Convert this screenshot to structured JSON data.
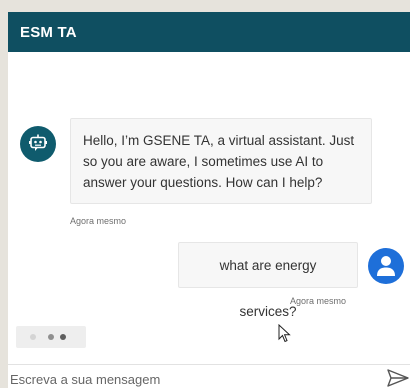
{
  "header": {
    "title": "ESM TA"
  },
  "messages": [
    {
      "sender": "bot",
      "avatar_icon": "bot-icon",
      "text": "Hello, I’m GSENE TA, a virtual assistant. Just so you are aware, I sometimes use AI to answer your questions. How can I help?",
      "timestamp": "Agora mesmo"
    },
    {
      "sender": "user",
      "avatar_icon": "user-icon",
      "text": "what are energy services?",
      "timestamp": "Agora mesmo"
    }
  ],
  "composer": {
    "placeholder": "Escreva a sua mensagem",
    "value": "",
    "send_icon": "send-icon"
  },
  "colors": {
    "header_bg": "#0f4f61",
    "bot_avatar_bg": "#0f5b6d",
    "user_avatar_bg": "#1e6fd9",
    "bubble_bg": "#f7f7f7"
  }
}
